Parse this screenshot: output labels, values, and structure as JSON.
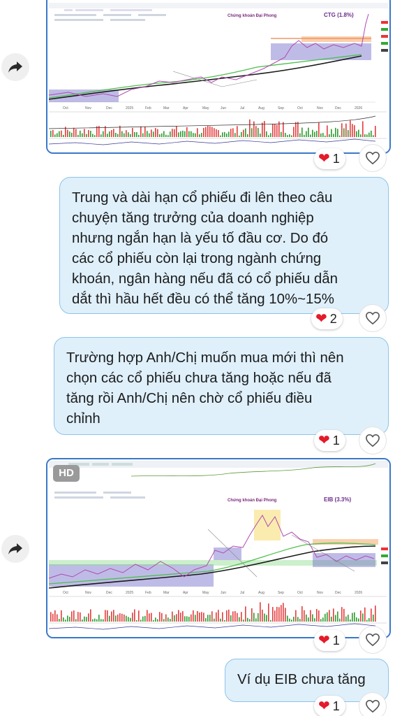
{
  "messages": [
    {
      "type": "image",
      "chart": {
        "ticker": "CTG (1.8%)",
        "watermark": "Chứng khoán Đại Phong",
        "months": [
          "Oct",
          "Nov",
          "Dec",
          "2025",
          "Feb",
          "Mar",
          "Apr",
          "May",
          "Jun",
          "Jul",
          "Aug",
          "Sep",
          "Oct",
          "Nov",
          "Dec",
          "2026"
        ]
      },
      "reaction": {
        "emoji": "heart",
        "count": "1"
      }
    },
    {
      "type": "text",
      "lines": [
        "Trung và dài hạn cổ phiếu đi lên theo câu",
        "chuyện tăng trưởng của doanh nghiệp",
        "nhưng ngắn hạn là yếu tố đầu cơ. Do đó",
        "các cổ phiếu còn lại trong ngành chứng",
        "khoán, ngân hàng nếu đã có cổ phiếu dẫn",
        "dắt thì hầu hết đều có thể tăng 10%~15%"
      ],
      "reaction": {
        "emoji": "heart",
        "count": "2"
      }
    },
    {
      "type": "text",
      "lines": [
        "Trường hợp Anh/Chị muốn mua mới thì nên",
        "chọn các cổ phiếu chưa tăng hoặc nếu đã",
        "tăng rồi Anh/Chị nên chờ cổ phiếu điều",
        "chỉnh"
      ],
      "reaction": {
        "emoji": "heart",
        "count": "1"
      }
    },
    {
      "type": "image",
      "badge": "HD",
      "chart": {
        "ticker": "EIB (3.3%)",
        "watermark": "Chứng khoán Đại Phong",
        "months": [
          "Oct",
          "Nov",
          "Dec",
          "2025",
          "Feb",
          "Mar",
          "Apr",
          "May",
          "Jun",
          "Jul",
          "Aug",
          "Sep",
          "Oct",
          "Nov",
          "Dec",
          "2026"
        ]
      },
      "reaction": {
        "emoji": "heart",
        "count": "1"
      }
    },
    {
      "type": "text",
      "lines": [
        "Ví dụ EIB chưa tăng"
      ],
      "reaction": {
        "emoji": "heart",
        "count": "1"
      }
    }
  ],
  "icons": {
    "forward": "share-forward-icon",
    "like": "heart-outline-icon"
  },
  "colors": {
    "bubble_bg": "#dff0fb",
    "bubble_border": "#8ec3e8",
    "heart": "#e31b2a",
    "image_border": "#3a78c8"
  }
}
